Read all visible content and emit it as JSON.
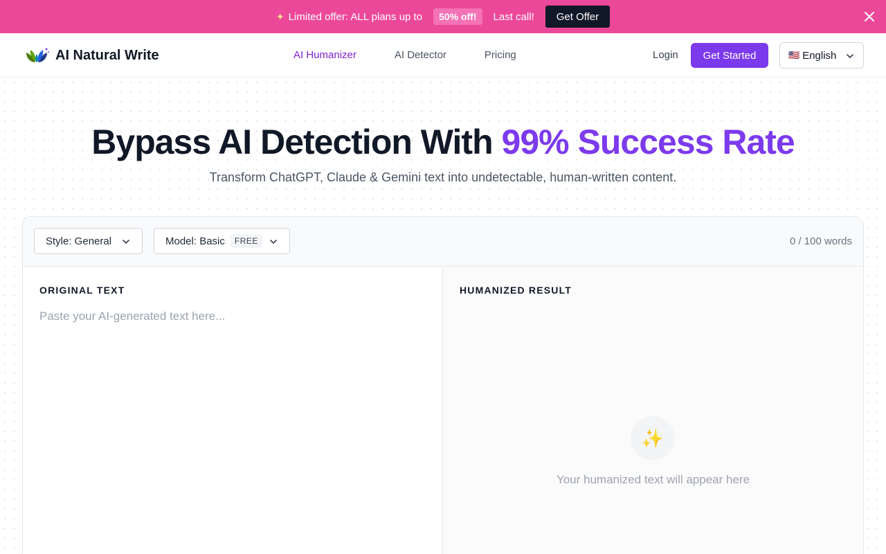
{
  "promo": {
    "text": "Limited offer: ALL plans up to",
    "discount": "50% off!",
    "last_call": "Last call!",
    "button": "Get Offer",
    "bg_color": "#ec4899"
  },
  "nav": {
    "brand": "AI Natural Write",
    "links": [
      {
        "label": "AI Humanizer",
        "active": true
      },
      {
        "label": "AI Detector",
        "active": false
      },
      {
        "label": "Pricing",
        "active": false
      }
    ],
    "login": "Login",
    "get_started": "Get Started",
    "language": "English",
    "accent_color": "#7c3aed"
  },
  "hero": {
    "title": "Bypass AI Detection With",
    "title_accent": "99% Success Rate",
    "subtitle": "Transform ChatGPT, Claude & Gemini text into undetectable, human-written content."
  },
  "editor": {
    "style_select": "Style: General",
    "model_select": "Model: Basic",
    "model_badge": "FREE",
    "word_count": "0 / 100 words",
    "original_label": "ORIGINAL TEXT",
    "input_placeholder": "Paste your AI-generated text here...",
    "input_value": "",
    "result_label": "HUMANIZED RESULT",
    "result_icon": "sparkles-icon",
    "result_empty": "Your humanized text will appear here"
  }
}
